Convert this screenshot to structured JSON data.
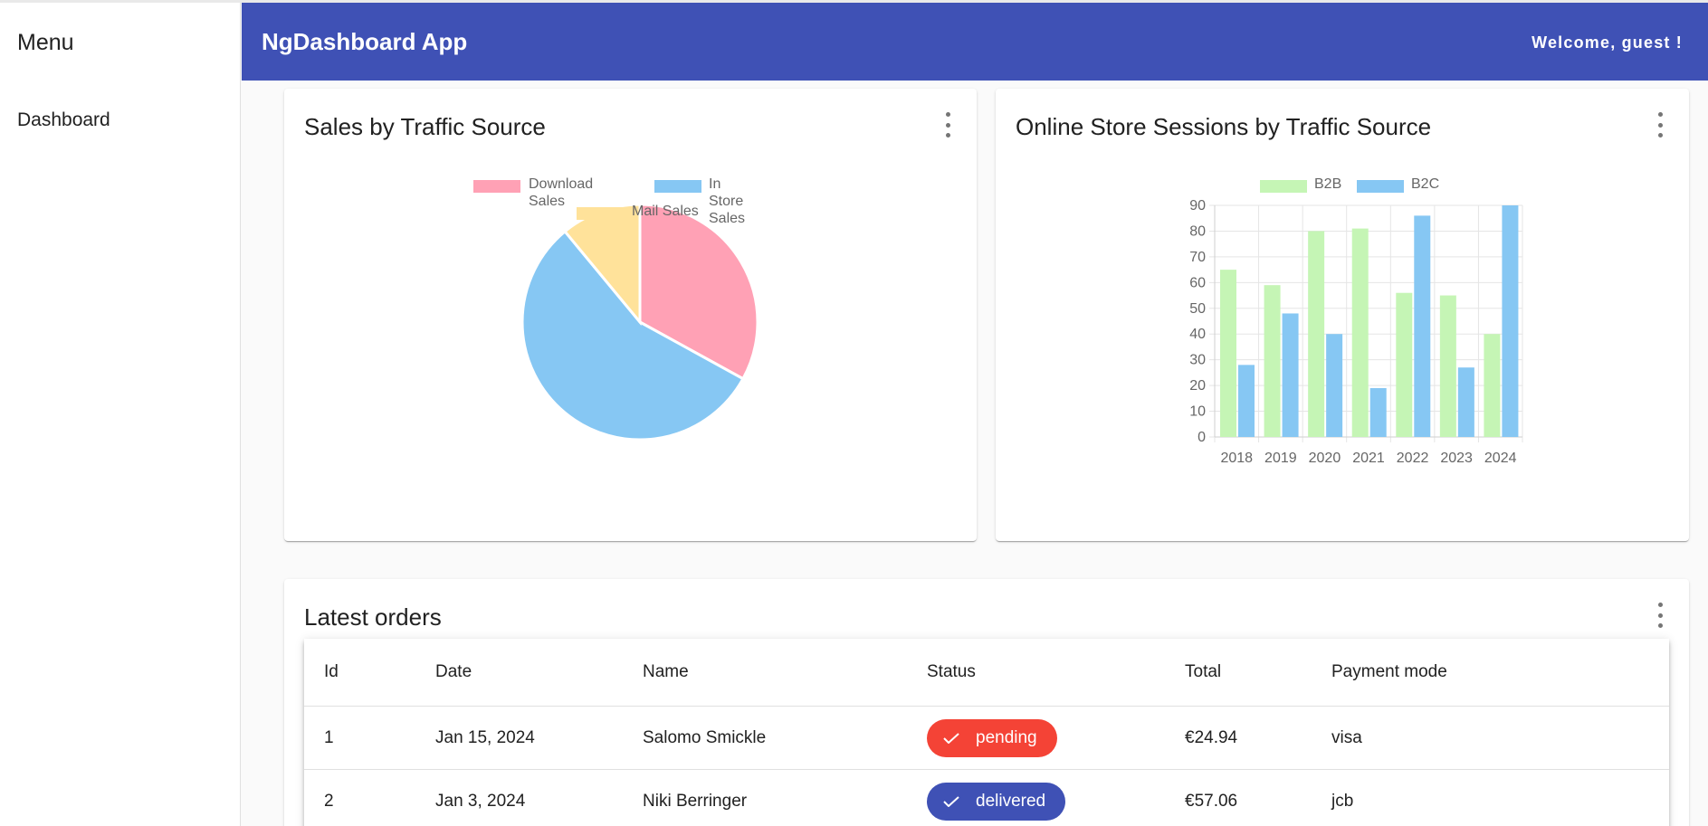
{
  "sidebar": {
    "title": "Menu",
    "items": [
      {
        "label": "Dashboard"
      }
    ]
  },
  "header": {
    "title": "NgDashboard App",
    "welcome": "Welcome, guest !"
  },
  "cards": {
    "pie": {
      "title": "Sales by Traffic Source"
    },
    "bar": {
      "title": "Online Store Sessions by Traffic Source"
    },
    "orders": {
      "title": "Latest orders"
    }
  },
  "chart_data": [
    {
      "type": "pie",
      "title": "Sales by Traffic Source",
      "legend_placement": "top",
      "categories": [
        "Download Sales",
        "In Store Sales",
        "Mail Sales"
      ],
      "values": [
        33,
        56,
        11
      ],
      "colors": [
        "#ffa1b5",
        "#86c7f3",
        "#ffe29a"
      ]
    },
    {
      "type": "bar",
      "title": "Online Store Sessions by Traffic Source",
      "legend_placement": "top",
      "categories": [
        "2018",
        "2019",
        "2020",
        "2021",
        "2022",
        "2023",
        "2024"
      ],
      "series": [
        {
          "name": "B2B",
          "values": [
            65,
            59,
            80,
            81,
            56,
            55,
            40
          ],
          "color": "#c5f5b5"
        },
        {
          "name": "B2C",
          "values": [
            28,
            48,
            40,
            19,
            86,
            27,
            90
          ],
          "color": "#86c7f3"
        }
      ],
      "ylim": [
        0,
        90
      ],
      "yticks": [
        0,
        10,
        20,
        30,
        40,
        50,
        60,
        70,
        80,
        90
      ],
      "grid": true
    }
  ],
  "orders": {
    "columns": [
      "Id",
      "Date",
      "Name",
      "Status",
      "Total",
      "Payment mode"
    ],
    "rows": [
      {
        "id": "1",
        "date": "Jan 15, 2024",
        "name": "Salomo Smickle",
        "status": "pending",
        "status_color": "#f44336",
        "total": "€24.94",
        "payment": "visa"
      },
      {
        "id": "2",
        "date": "Jan 3, 2024",
        "name": "Niki Berringer",
        "status": "delivered",
        "status_color": "#3f51b5",
        "total": "€57.06",
        "payment": "jcb"
      }
    ]
  },
  "icons": {
    "more": "more-vert-icon",
    "check": "check-icon"
  }
}
